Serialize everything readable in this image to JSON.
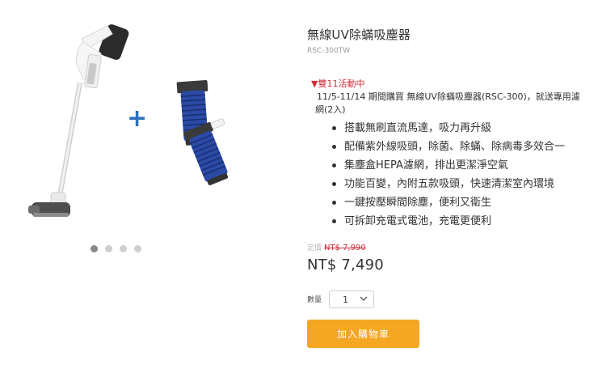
{
  "product": {
    "title": "無線UV除蟎吸塵器",
    "sku": "RSC-300TW"
  },
  "promo": {
    "title": "▼雙11活動中",
    "description": "11/5-11/14 期間購買 無線UV除蟎吸塵器(RSC-300)，就送專用濾網(2入)"
  },
  "features": [
    "搭載無刷直流馬達，吸力再升級",
    "配備紫外線吸頭，除菌、除蟎、除病毒多效合一",
    "集塵盒HEPA濾網，排出更潔淨空氣",
    "功能百變，內附五款吸頭，快速清潔室內環境",
    "一鍵按壓瞬間除塵，便利又衛生",
    "可拆卸充電式電池，充電更便利"
  ],
  "pricing": {
    "original_label": "定價",
    "original_price": "NT$ 7,990",
    "price": "NT$ 7,490"
  },
  "quantity": {
    "label": "數量",
    "value": "1"
  },
  "cart_button": "加入購物車",
  "gallery": {
    "plus_symbol": "+",
    "total_images": 4,
    "active_index": 0
  },
  "colors": {
    "promo_red": "#d0303c",
    "button_orange": "#f5a623",
    "plus_blue": "#2a6fbd",
    "filter_blue": "#2a4aa5"
  },
  "icons": [
    "chevron-down-icon"
  ]
}
